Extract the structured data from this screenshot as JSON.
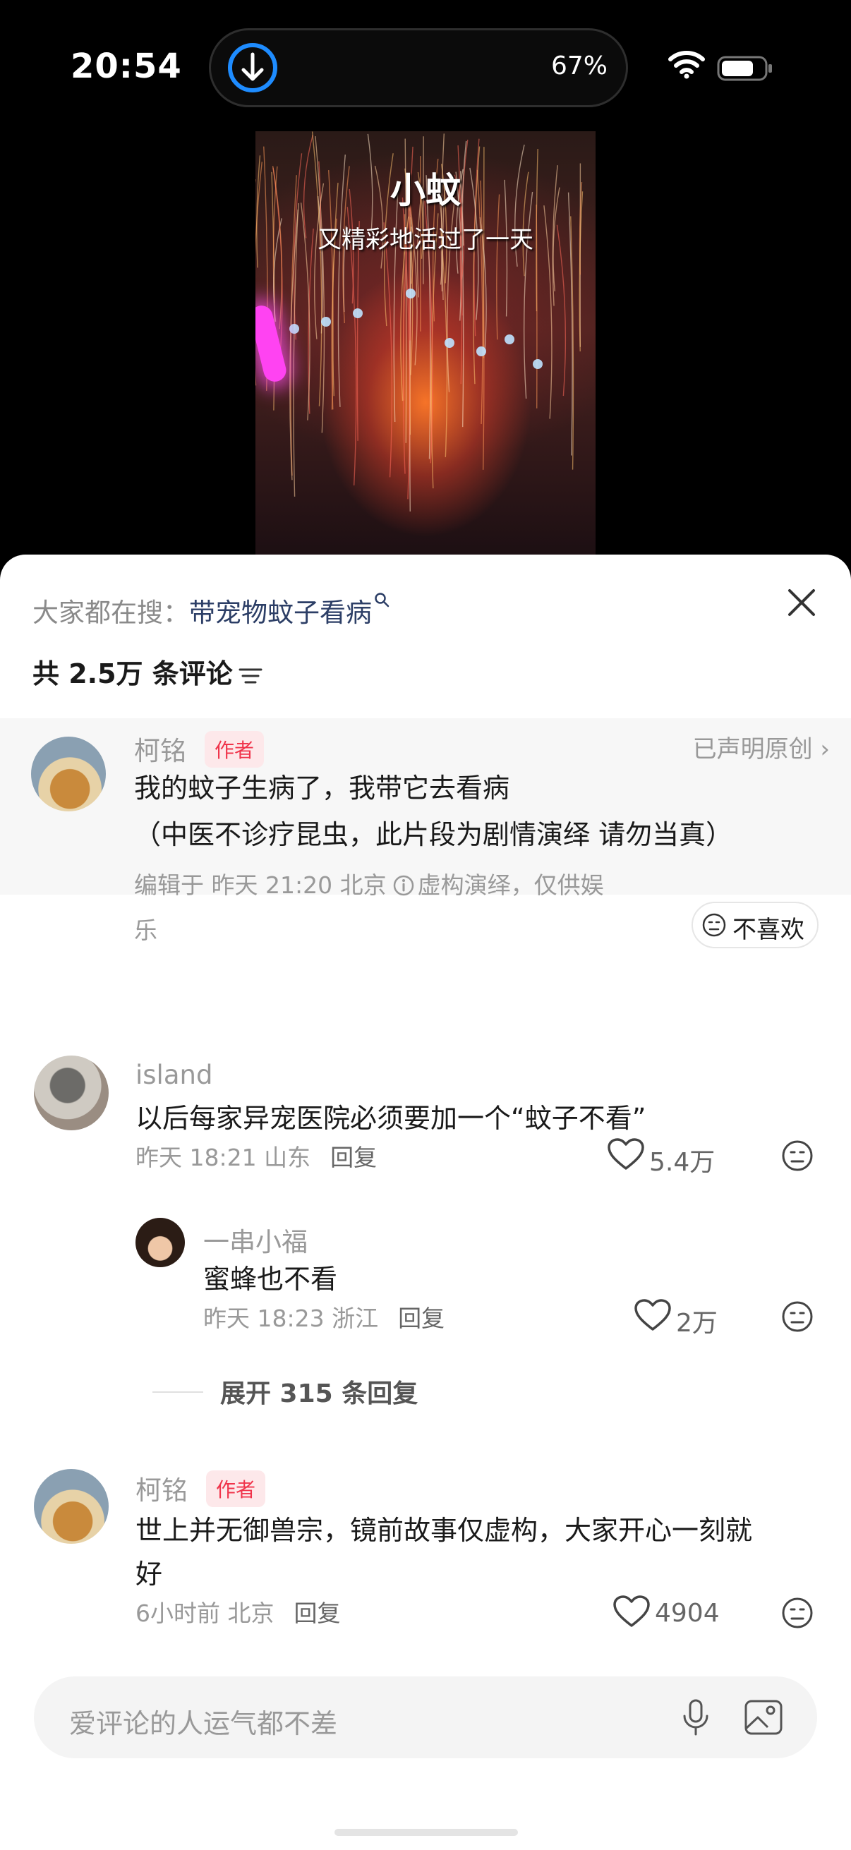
{
  "status_bar": {
    "time": "20:54",
    "battery_percent": "67%"
  },
  "video": {
    "caption_title": "小蚊",
    "caption_subtitle": "又精彩地活过了一天"
  },
  "header": {
    "search_prefix": "大家都在搜：",
    "search_keyword": "带宠物蚊子看病",
    "comment_count": "共 2.5万 条评论"
  },
  "pinned_comment": {
    "username": "柯铭",
    "author_tag": "作者",
    "original_label": "已声明原创 ›",
    "text_line1": "我的蚊子生病了，我带它去看病",
    "text_line2": "（中医不诊疗昆虫，此片段为剧情演绎  请勿当真）",
    "meta_prefix": "编辑于  昨天 21:20  北京",
    "meta_note_line1": "虚构演绎，仅供娱",
    "meta_note_line2": "乐",
    "dislike_label": "不喜欢"
  },
  "comments": [
    {
      "username": "island",
      "text": "以后每家异宠医院必须要加一个“蚊子不看”",
      "meta": "昨天 18:21 山东",
      "reply_label": "回复",
      "likes": "5.4万"
    },
    {
      "username": "柯铭",
      "author_tag": "作者",
      "text_line1": "世上并无御兽宗，镜前故事仅虚构，大家开心一刻就",
      "text_line2": "好",
      "meta": "6小时前 北京",
      "reply_label": "回复",
      "likes": "4904"
    }
  ],
  "reply": {
    "username": "一串小福",
    "text": "蜜蜂也不看",
    "meta": "昨天 18:23 浙江",
    "reply_label": "回复",
    "likes": "2万"
  },
  "expand_replies": "展开 315 条回复",
  "input": {
    "placeholder": "爱评论的人运气都不差"
  },
  "colors": {
    "author_tag": "#f0344b",
    "search_keyword": "#2c3e66",
    "download_ring": "#1e8cff"
  }
}
